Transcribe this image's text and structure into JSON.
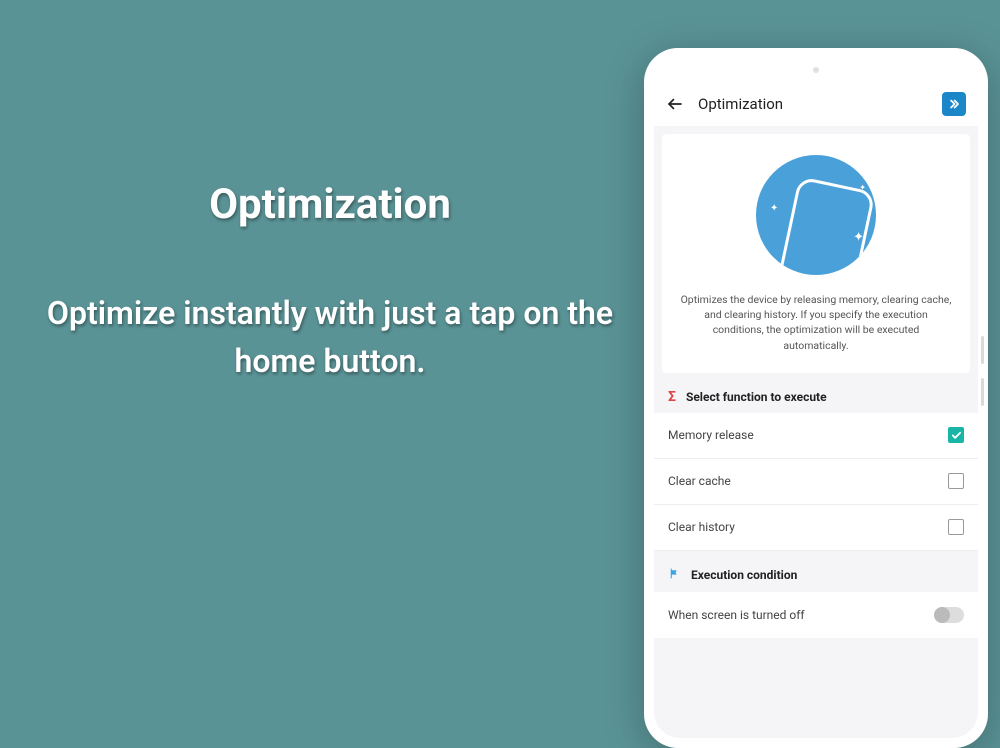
{
  "promo": {
    "title": "Optimization",
    "subtitle": "Optimize instantly with just a tap on the home button."
  },
  "appbar": {
    "title": "Optimization"
  },
  "hero": {
    "description": "Optimizes the device by releasing memory, clearing cache, and clearing history. If you specify the execution conditions, the optimization will be executed automatically."
  },
  "functions": {
    "header": "Select function to execute",
    "items": [
      {
        "label": "Memory release",
        "checked": true
      },
      {
        "label": "Clear cache",
        "checked": false
      },
      {
        "label": "Clear history",
        "checked": false
      }
    ]
  },
  "conditions": {
    "header": "Execution condition",
    "items": [
      {
        "label": "When screen is turned off"
      }
    ]
  }
}
